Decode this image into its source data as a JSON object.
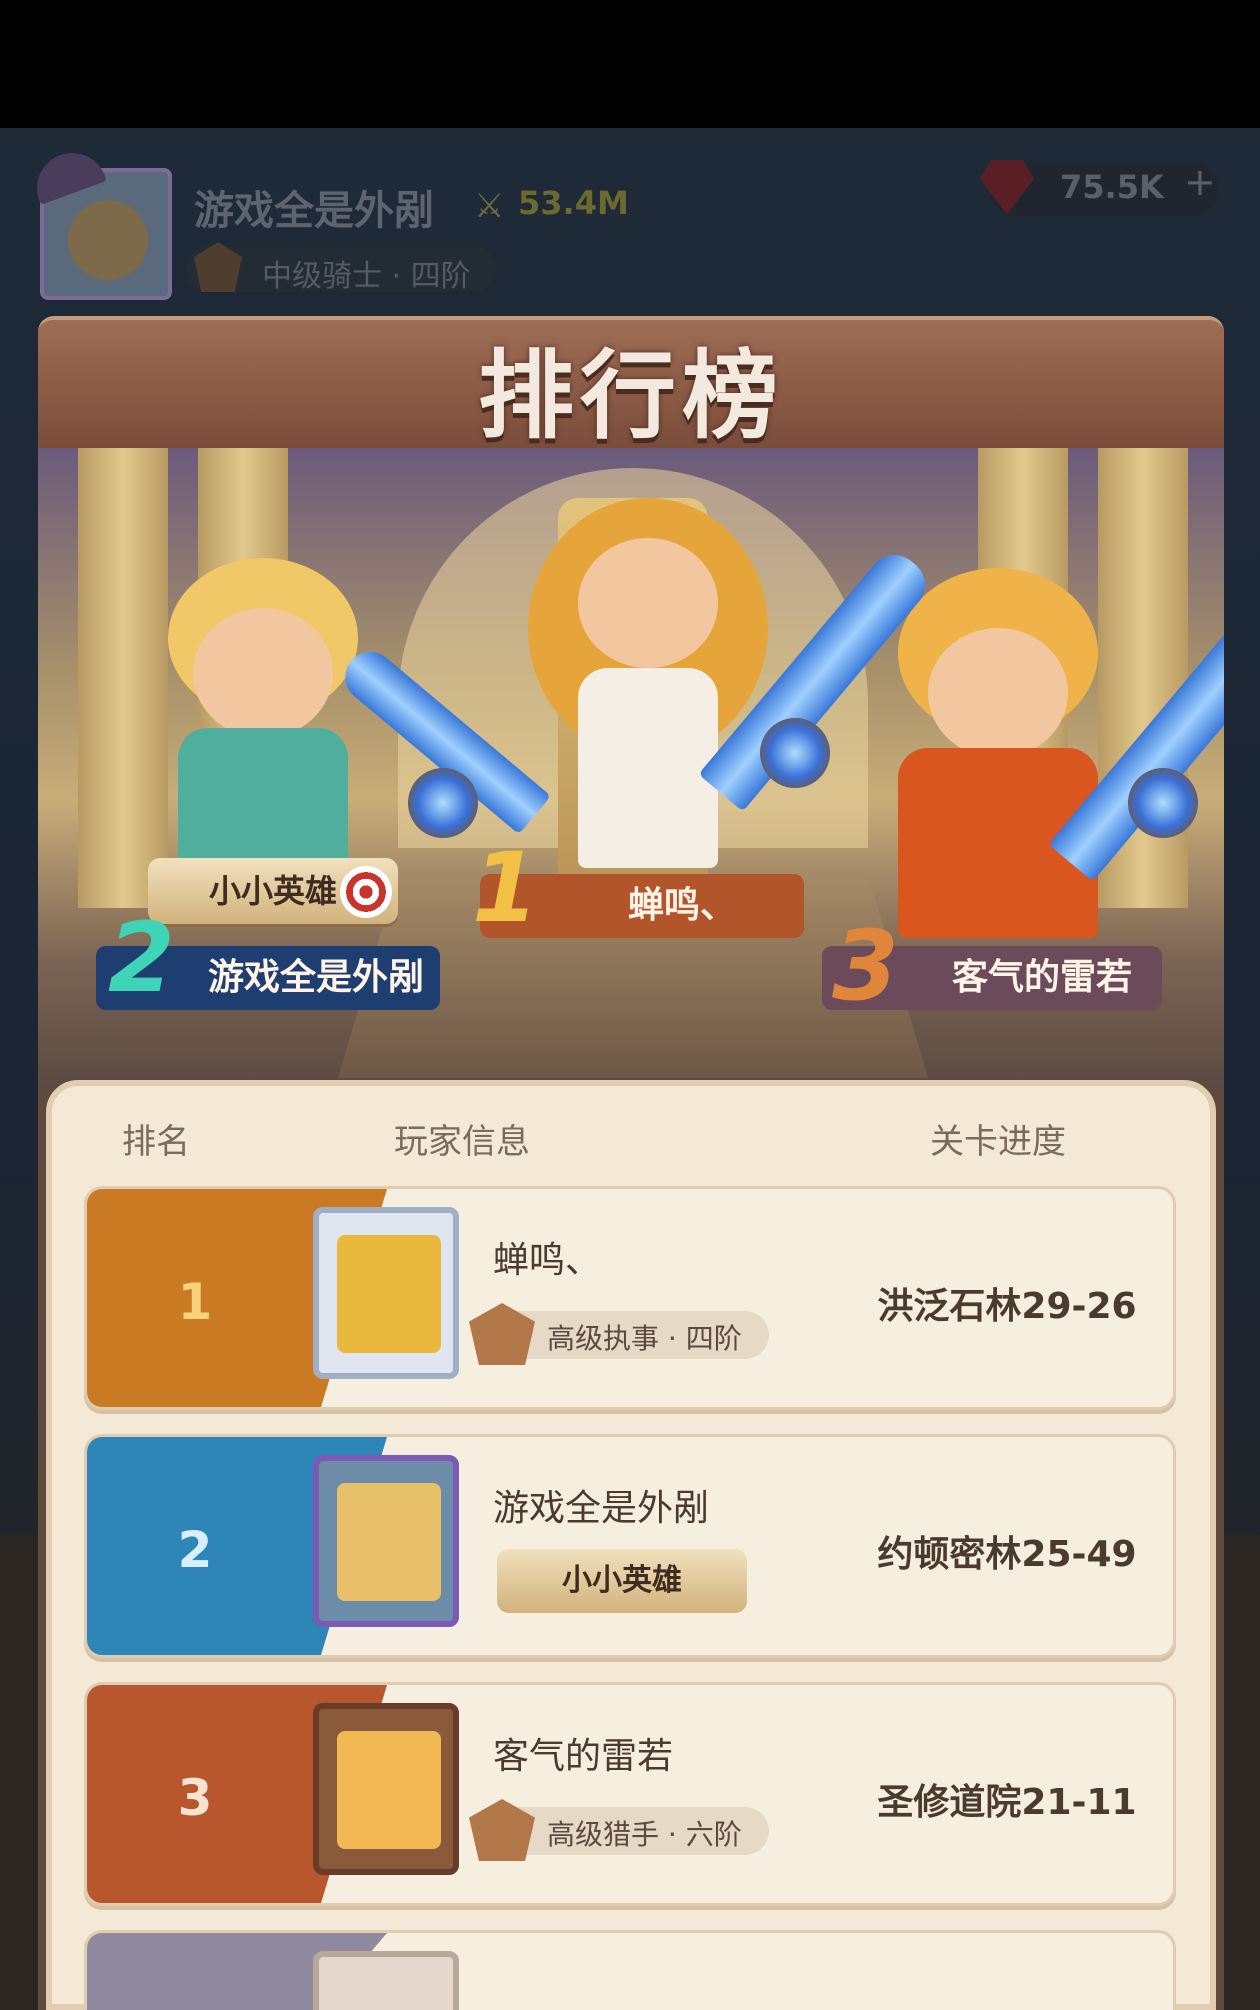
{
  "hud": {
    "player_name": "游戏全是外剐",
    "power": "53.4M",
    "rank_title": "中级骑士 · 四阶",
    "gems": "75.5K",
    "plus": "+"
  },
  "panel_title": "排行榜",
  "podium": {
    "first": {
      "rank": "1",
      "name": "蝉鸣、"
    },
    "second": {
      "rank": "2",
      "name": "游戏全是外剐",
      "title_badge": "小小英雄"
    },
    "third": {
      "rank": "3",
      "name": "客气的雷若"
    }
  },
  "columns": {
    "rank": "排名",
    "player_info": "玩家信息",
    "progress": "关卡进度"
  },
  "rows": [
    {
      "rank": "1",
      "name": "蝉鸣、",
      "rank_title": "高级执事 · 四阶",
      "progress": "洪泛石林29-26",
      "color": "#c97a22"
    },
    {
      "rank": "2",
      "name": "游戏全是外剐",
      "title_badge": "小小英雄",
      "progress": "约顿密林25-49",
      "color": "#2e86b8"
    },
    {
      "rank": "3",
      "name": "客气的雷若",
      "rank_title": "高级猎手 · 六阶",
      "progress": "圣修道院21-11",
      "color": "#b8562e"
    }
  ]
}
